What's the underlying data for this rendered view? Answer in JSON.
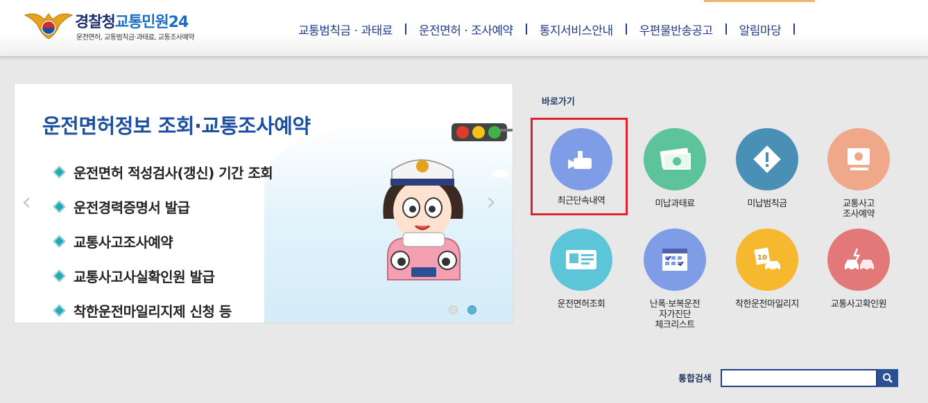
{
  "header": {
    "logo_title_a": "경찰청",
    "logo_title_b": "교통민원24",
    "logo_sub": "운전면허, 교통범칙금·과태료, 교통조사예약",
    "nav": [
      "교통범칙금 · 과태료",
      "운전면허 · 조사예약",
      "통지서비스안내",
      "우편물반송공고",
      "알림마당"
    ]
  },
  "banner": {
    "title": "운전면허정보 조회·교통조사예약",
    "items": [
      "운전면허 적성검사(갱신) 기간 조회",
      "운전경력증명서 발급",
      "교통사고조사예약",
      "교통사고사실확인원 발급",
      "착한운전마일리지제 신청 등"
    ],
    "slide_count": 2,
    "active_slide": 2
  },
  "quick": {
    "label": "바로가기",
    "items": [
      {
        "label": "최근단속내역",
        "color": "#7f9de6",
        "icon": "camera-icon"
      },
      {
        "label": "미납과태료",
        "color": "#5cc39a",
        "icon": "banknote-icon"
      },
      {
        "label": "미납범칙금",
        "color": "#4a8fb6",
        "icon": "warning-diamond-icon"
      },
      {
        "label": "교통사고\n조사예약",
        "color": "#f0a88a",
        "icon": "monitor-icon"
      },
      {
        "label": "운전면허조회",
        "color": "#5cc6d8",
        "icon": "id-card-icon"
      },
      {
        "label": "난폭·보복운전\n자가진단\n체크리스트",
        "color": "#7f9de6",
        "icon": "calendar-check-icon"
      },
      {
        "label": "착한운전마일리지",
        "color": "#f5b82e",
        "icon": "mileage-car-icon"
      },
      {
        "label": "교통사고확인원",
        "color": "#e27878",
        "icon": "car-crash-icon"
      }
    ]
  },
  "search": {
    "label": "통합검색",
    "value": ""
  }
}
